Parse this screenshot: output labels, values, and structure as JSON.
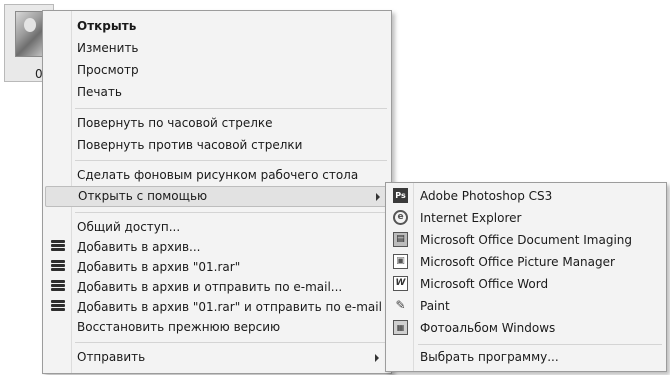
{
  "file": {
    "label": "0"
  },
  "menu": {
    "items": [
      {
        "label": "Открыть",
        "bold": true
      },
      {
        "label": "Изменить"
      },
      {
        "label": "Просмотр"
      },
      {
        "label": "Печать"
      },
      {
        "label": "Повернуть по часовой стрелке"
      },
      {
        "label": "Повернуть против часовой стрелки"
      },
      {
        "label": "Сделать фоновым рисунком рабочего стола"
      },
      {
        "label": "Открыть с помощью",
        "submenu": true,
        "highlighted": true
      },
      {
        "label": "Общий доступ..."
      },
      {
        "label": "Добавить в архив...",
        "icon": "winrar-icon"
      },
      {
        "label": "Добавить в архив \"01.rar\"",
        "icon": "winrar-icon"
      },
      {
        "label": "Добавить в архив и отправить по e-mail...",
        "icon": "winrar-icon"
      },
      {
        "label": "Добавить в архив \"01.rar\" и отправить по e-mail",
        "icon": "winrar-icon"
      },
      {
        "label": "Восстановить прежнюю версию"
      },
      {
        "label": "Отправить",
        "submenu": true
      }
    ]
  },
  "submenu": {
    "items": [
      {
        "label": "Adobe Photoshop CS3",
        "icon": "photoshop-icon",
        "glyph": "Ps"
      },
      {
        "label": "Internet Explorer",
        "icon": "internet-explorer-icon",
        "glyph": "e"
      },
      {
        "label": "Microsoft Office Document Imaging",
        "icon": "document-imaging-icon",
        "glyph": "▤"
      },
      {
        "label": "Microsoft Office Picture Manager",
        "icon": "picture-manager-icon",
        "glyph": "▣"
      },
      {
        "label": "Microsoft Office Word",
        "icon": "word-icon",
        "glyph": "W"
      },
      {
        "label": "Paint",
        "icon": "paint-icon",
        "glyph": "✎"
      },
      {
        "label": "Фотоальбом Windows",
        "icon": "photo-album-icon",
        "glyph": "▦"
      },
      {
        "label": "Выбрать программу..."
      }
    ]
  }
}
